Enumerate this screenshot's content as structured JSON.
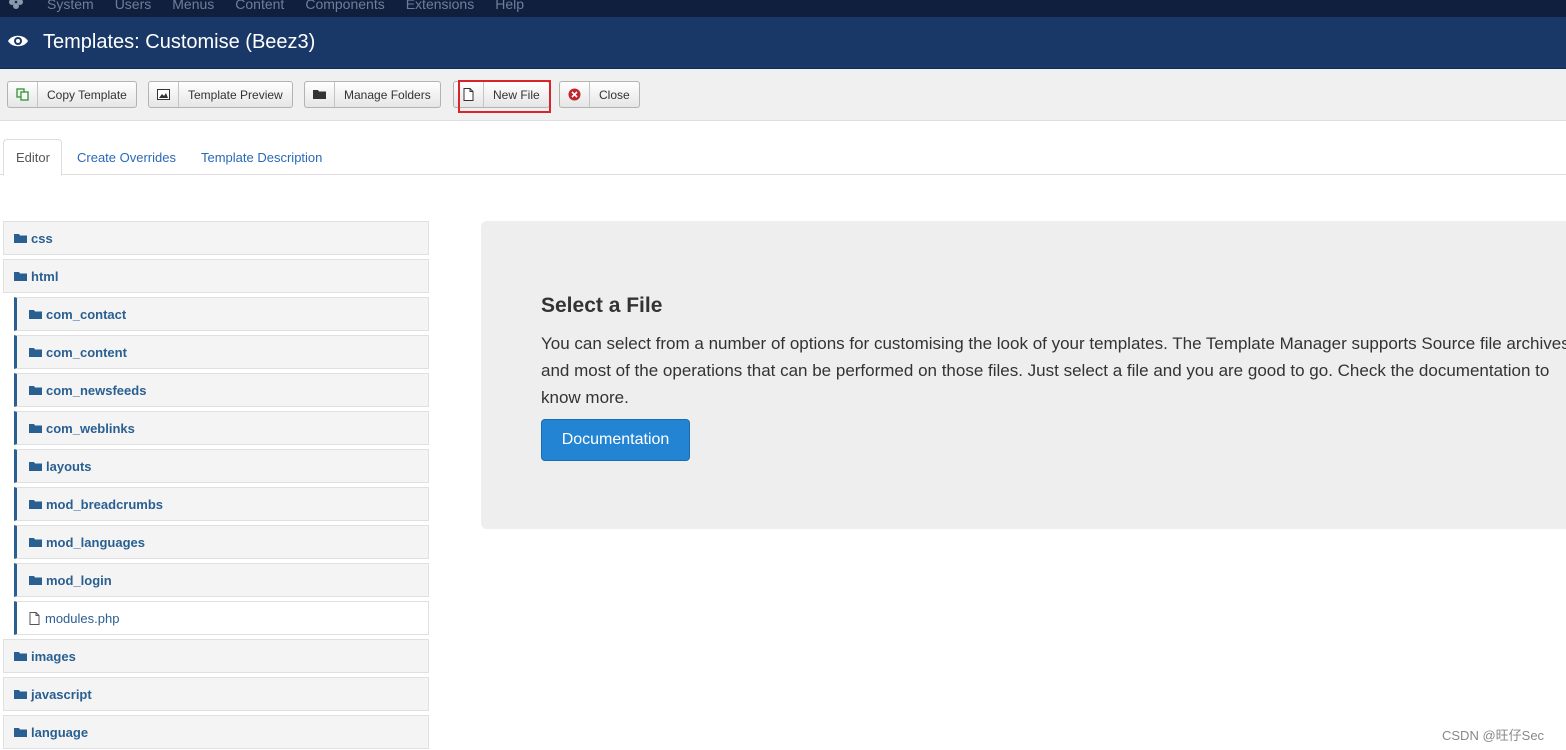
{
  "topmenu": [
    "System",
    "Users",
    "Menus",
    "Content",
    "Components",
    "Extensions",
    "Help"
  ],
  "header": {
    "title": "Templates: Customise (Beez3)"
  },
  "toolbar": {
    "copy_template": "Copy Template",
    "template_preview": "Template Preview",
    "manage_folders": "Manage Folders",
    "new_file": "New File",
    "close": "Close"
  },
  "tabs": [
    "Editor",
    "Create Overrides",
    "Template Description"
  ],
  "tree": {
    "css": "css",
    "html": "html",
    "children": [
      "com_contact",
      "com_content",
      "com_newsfeeds",
      "com_weblinks",
      "layouts",
      "mod_breadcrumbs",
      "mod_languages",
      "mod_login"
    ],
    "file": "modules.php",
    "images": "images",
    "javascript": "javascript",
    "language": "language"
  },
  "panel": {
    "heading": "Select a File",
    "text": "You can select from a number of options for customising the look of your templates. The Template Manager supports Source file archives and most of the operations that can be performed on those files. Just select a file and you are good to go. Check the documentation to know more.",
    "button": "Documentation"
  },
  "watermark": "CSDN @旺仔Sec",
  "colors": {
    "titlebar": "#1a3867",
    "link": "#2a5f91",
    "button": "#2384d3",
    "highlight": "#d9232d"
  }
}
